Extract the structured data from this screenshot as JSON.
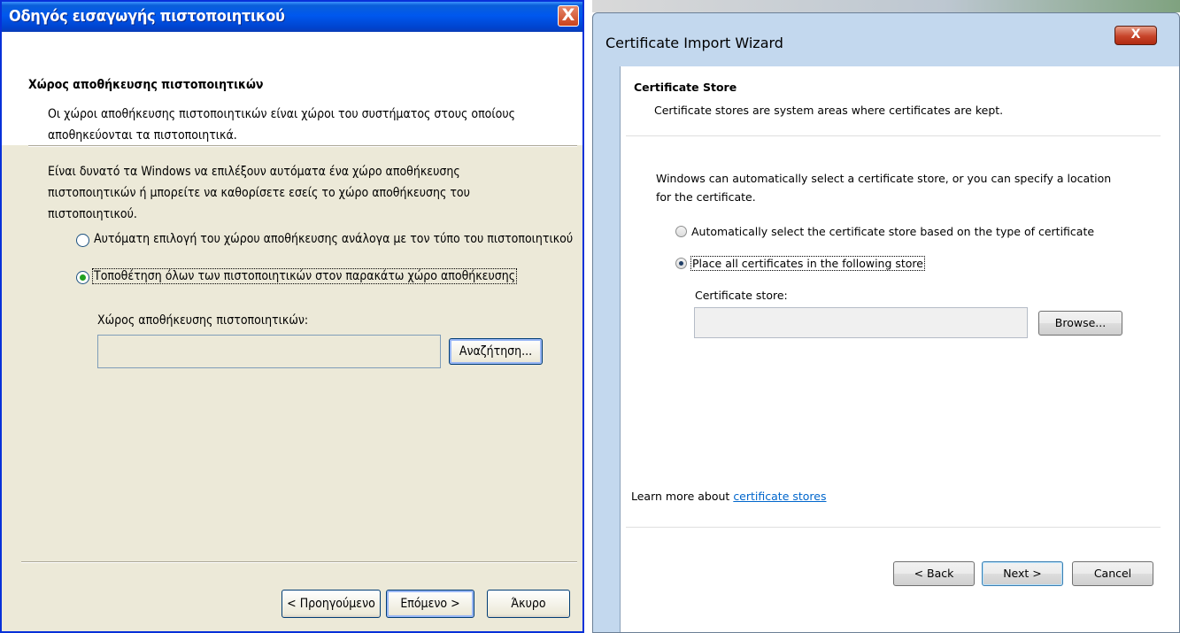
{
  "left_dialog": {
    "title": "Οδηγός εισαγωγής πιστοποιητικού",
    "close_glyph": "X",
    "header_title": "Χώρος αποθήκευσης πιστοποιητικών",
    "header_desc_line1": "Οι χώροι αποθήκευσης πιστοποιητικών είναι χώροι του συστήματος στους οποίους",
    "header_desc_line2": "αποθηκεύονται τα πιστοποιητικά.",
    "body_line1": "Είναι δυνατό τα Windows να επιλέξουν αυτόματα ένα χώρο αποθήκευσης",
    "body_line2": "πιστοποιητικών ή μπορείτε να καθορίσετε εσείς το χώρο αποθήκευσης του",
    "body_line3": "πιστοποιητικού.",
    "radio_auto_label": "Αυτόματη επιλογή του χώρου αποθήκευσης ανάλογα με τον τύπο του πιστοποιητικού",
    "radio_auto_selected": false,
    "radio_place_label": "Τοποθέτηση όλων των πιστοποιητικών στον παρακάτω χώρο αποθήκευσης",
    "radio_place_selected": true,
    "store_label": "Χώρος αποθήκευσης πιστοποιητικών:",
    "store_value": "",
    "browse_label": "Αναζήτηση...",
    "back_label": "< Προηγούμενο",
    "next_label": "Επόμενο >",
    "cancel_label": "Άκυρο"
  },
  "right_dialog": {
    "title": "Certificate Import Wizard",
    "close_glyph": "X",
    "header_title": "Certificate Store",
    "header_desc": "Certificate stores are system areas where certificates are kept.",
    "body_line1": "Windows can automatically select a certificate store, or you can specify a location",
    "body_line2": "for the certificate.",
    "radio_auto_label": "Automatically select the certificate store based on the type of certificate",
    "radio_auto_selected": false,
    "radio_place_label": "Place all certificates in the following store",
    "radio_place_selected": true,
    "store_label": "Certificate store:",
    "store_value": "",
    "browse_label": "Browse...",
    "learn_more_prefix": "Learn more about ",
    "learn_more_link": "certificate stores",
    "back_label": "< Back",
    "next_label": "Next >",
    "cancel_label": "Cancel"
  },
  "colors": {
    "xp_titlebar": "#0058ee",
    "xp_face": "#ece9d8",
    "xp_radio_dot": "#21a121",
    "w7_frame": "#c3d8ee",
    "link": "#0066cc"
  },
  "icons": {
    "close": "close-icon"
  }
}
